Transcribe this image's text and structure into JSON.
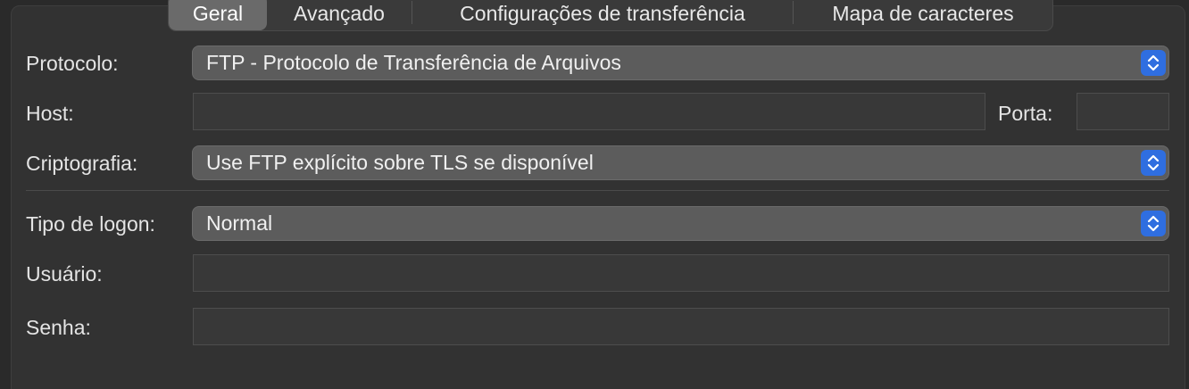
{
  "tabs": [
    {
      "label": "Geral",
      "active": true
    },
    {
      "label": "Avançado",
      "active": false
    },
    {
      "label": "Configurações de transferência",
      "active": false
    },
    {
      "label": "Mapa de caracteres",
      "active": false
    }
  ],
  "form": {
    "protocol_label": "Protocolo:",
    "protocol_value": "FTP - Protocolo de Transferência de Arquivos",
    "host_label": "Host:",
    "host_value": "",
    "port_label": "Porta:",
    "port_value": "",
    "encryption_label": "Criptografia:",
    "encryption_value": "Use FTP explícito sobre TLS se disponível",
    "logon_type_label": "Tipo de logon:",
    "logon_type_value": "Normal",
    "user_label": "Usuário:",
    "user_value": "",
    "password_label": "Senha:",
    "password_value": ""
  },
  "colors": {
    "accent": "#2f6ee0",
    "panel": "#323232",
    "select_bg": "#5c5c5c"
  },
  "icons": {
    "select_stepper": "chevron-up-down-icon"
  }
}
